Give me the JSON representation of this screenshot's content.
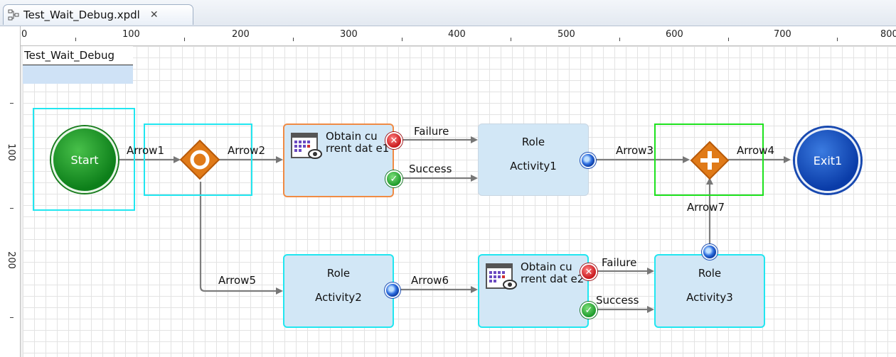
{
  "tab": {
    "title": "Test_Wait_Debug.xpdl",
    "icon": "xpdl-file-icon",
    "close_icon": "close-icon"
  },
  "ruler": {
    "h_labels": [
      "0",
      "100",
      "200",
      "300",
      "400",
      "500",
      "600",
      "700",
      "800"
    ],
    "v_labels": [
      "100",
      "200"
    ]
  },
  "pool": {
    "name": "Test_Wait_Debug"
  },
  "nodes": {
    "start": "Start",
    "exit": "Exit1",
    "task1": "Obtain cu rrent dat e1",
    "task2": "Obtain cu rrent dat e2",
    "role1": {
      "line1": "Role",
      "line2": "Activity1"
    },
    "role2": {
      "line1": "Role",
      "line2": "Activity2"
    },
    "role3": {
      "line1": "Role",
      "line2": "Activity3"
    }
  },
  "edges": {
    "arrow1": "Arrow1",
    "arrow2": "Arrow2",
    "arrow3": "Arrow3",
    "arrow4": "Arrow4",
    "arrow5": "Arrow5",
    "arrow6": "Arrow6",
    "arrow7": "Arrow7",
    "failure1": "Failure",
    "success1": "Success",
    "failure2": "Failure",
    "success2": "Success"
  },
  "colors": {
    "selection": "#21e6f0",
    "selection_green": "#1ee21e",
    "activity_fill": "#d2e7f6",
    "gateway": "#e07a18"
  }
}
